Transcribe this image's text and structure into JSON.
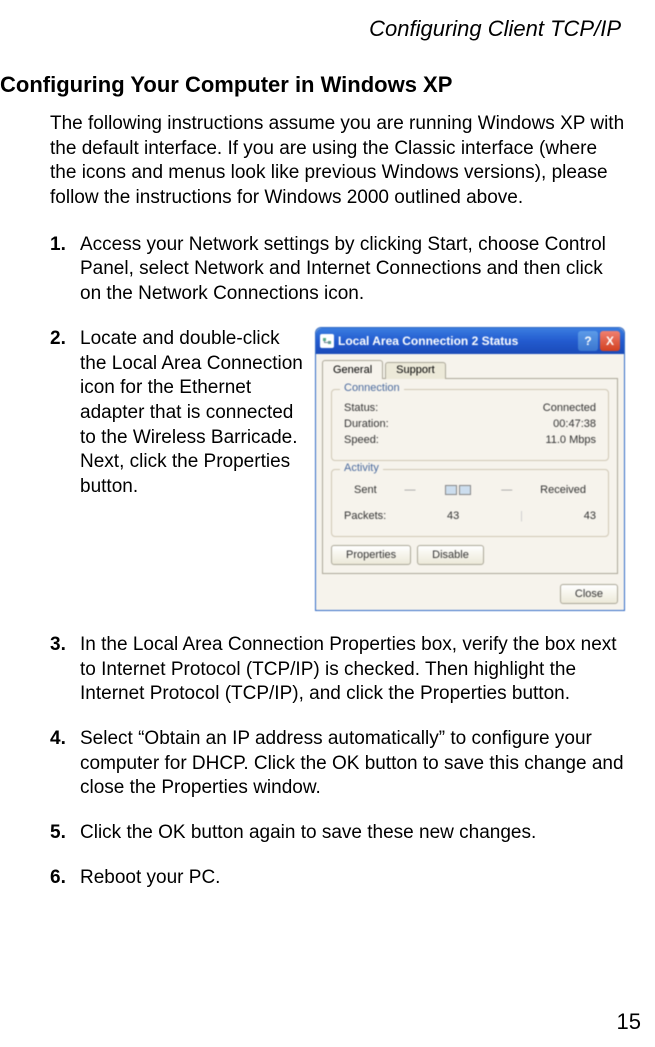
{
  "header": {
    "running_title": "Configuring Client TCP/IP"
  },
  "section": {
    "heading": "Configuring Your Computer in Windows XP",
    "intro": "The following instructions assume you are running Windows XP with the default interface. If you are using the Classic interface (where the icons and menus look like previous Windows versions), please follow the instructions for Windows 2000 outlined above."
  },
  "steps": {
    "s1": {
      "num": "1.",
      "text": "Access your Network settings by clicking Start, choose Control Panel, select Network and Internet Connections and then click on the Network Connections icon."
    },
    "s2": {
      "num": "2.",
      "text": "Locate and double-click the Local Area Connection icon for the Ethernet adapter that is connected to the Wireless Barricade. Next, click the Properties button."
    },
    "s3": {
      "num": "3.",
      "text": "In the Local Area Connection Properties box, verify the box next to Internet Protocol (TCP/IP) is checked. Then highlight the Internet Protocol (TCP/IP), and click the Properties button."
    },
    "s4": {
      "num": "4.",
      "text": "Select “Obtain an IP address automatically” to configure your computer for DHCP. Click the OK button to save this change and close the Properties window."
    },
    "s5": {
      "num": "5.",
      "text": "Click the OK button again to save these new changes."
    },
    "s6": {
      "num": "6.",
      "text": "Reboot your PC."
    }
  },
  "xp_dialog": {
    "title": "Local Area Connection 2 Status",
    "help_glyph": "?",
    "close_glyph": "X",
    "tabs": {
      "general": "General",
      "support": "Support"
    },
    "connection": {
      "legend": "Connection",
      "status_label": "Status:",
      "status_value": "Connected",
      "duration_label": "Duration:",
      "duration_value": "00:47:38",
      "speed_label": "Speed:",
      "speed_value": "11.0 Mbps"
    },
    "activity": {
      "legend": "Activity",
      "sent_label": "Sent",
      "received_label": "Received",
      "packets_label": "Packets:",
      "sent_value": "43",
      "received_value": "43"
    },
    "buttons": {
      "properties": "Properties",
      "disable": "Disable",
      "close": "Close"
    }
  },
  "page_number": "15"
}
